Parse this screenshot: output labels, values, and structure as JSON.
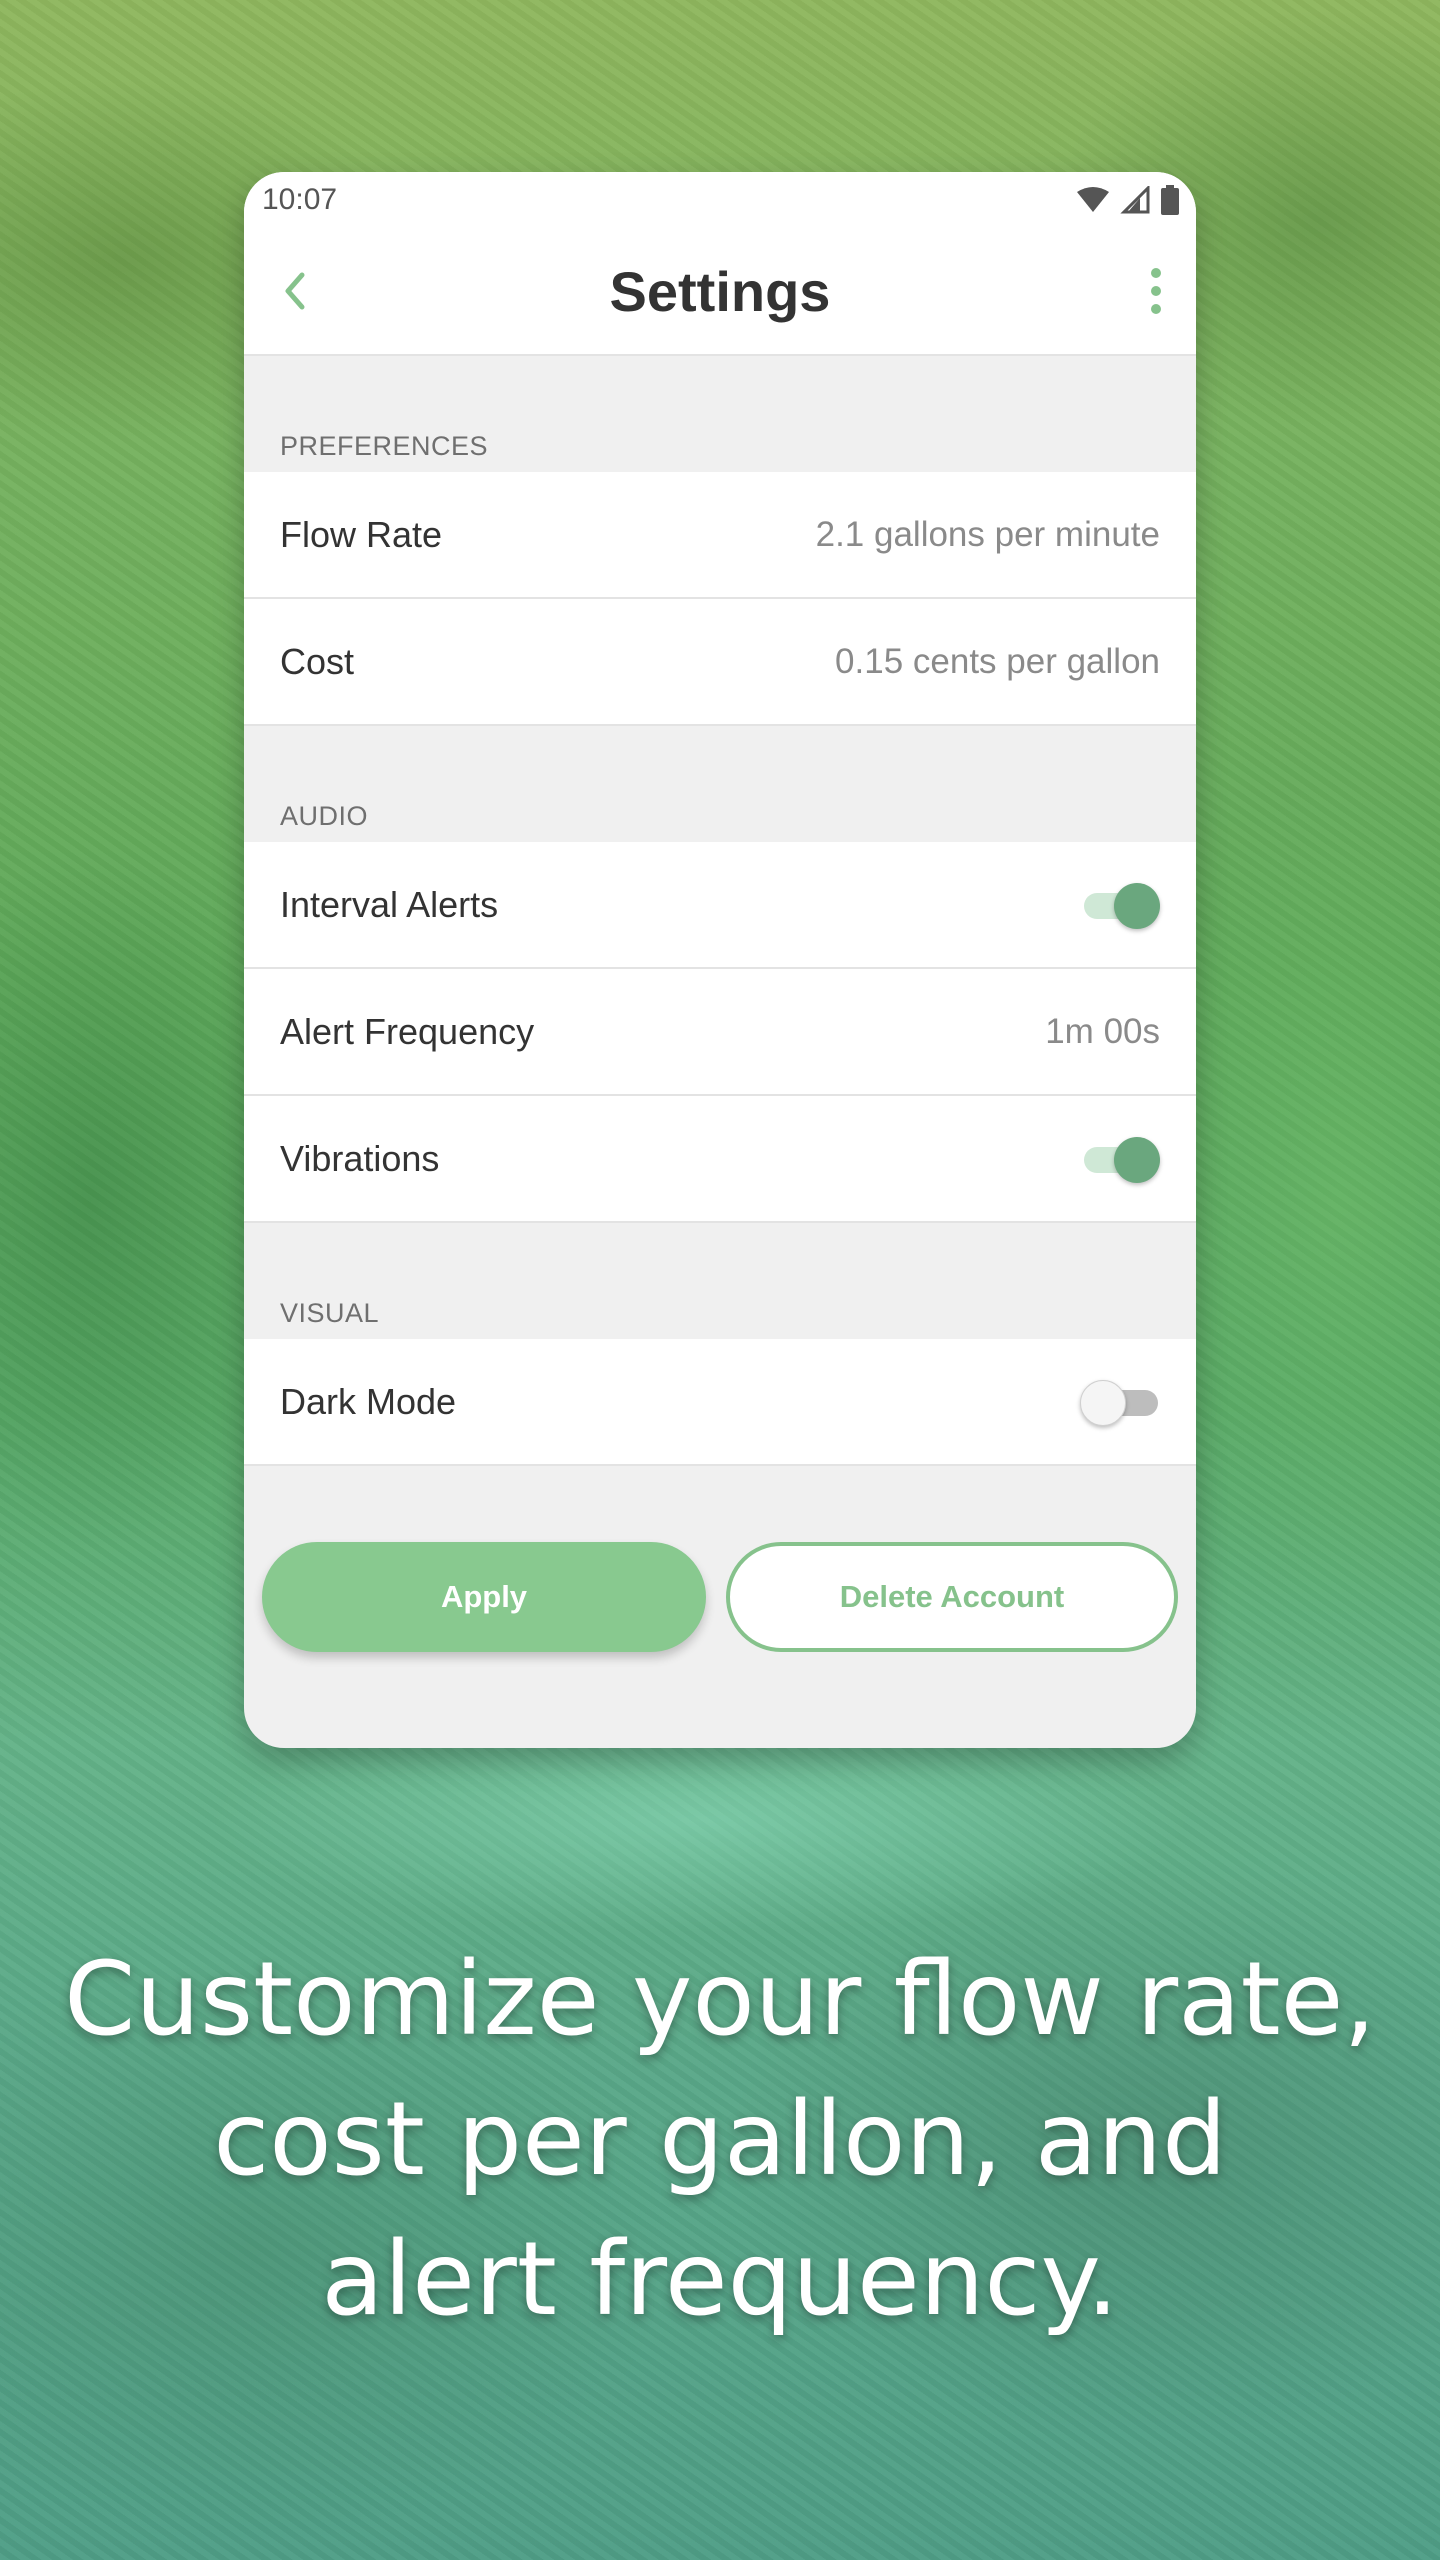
{
  "status_bar": {
    "time": "10:07",
    "icons": [
      "wifi-icon",
      "signal-icon",
      "battery-icon"
    ]
  },
  "app_bar": {
    "title": "Settings",
    "back_icon": "chevron-left-icon",
    "menu_icon": "more-vertical-icon"
  },
  "sections": {
    "preferences": {
      "header": "PREFERENCES",
      "flow_rate": {
        "label": "Flow Rate",
        "value": "2.1 gallons per minute"
      },
      "cost": {
        "label": "Cost",
        "value": "0.15 cents per gallon"
      }
    },
    "audio": {
      "header": "AUDIO",
      "interval_alerts": {
        "label": "Interval Alerts",
        "on": true
      },
      "alert_frequency": {
        "label": "Alert Frequency",
        "value": "1m 00s"
      },
      "vibrations": {
        "label": "Vibrations",
        "on": true
      }
    },
    "visual": {
      "header": "VISUAL",
      "dark_mode": {
        "label": "Dark Mode",
        "on": false
      }
    }
  },
  "actions": {
    "apply_label": "Apply",
    "delete_label": "Delete Account"
  },
  "caption": {
    "line1": "Customize your flow rate,",
    "line2": "cost per gallon, and",
    "line3": "alert frequency."
  },
  "colors": {
    "accent": "#88c98f",
    "toggle_on": "#6aa77e",
    "icon_green": "#86c28c"
  }
}
